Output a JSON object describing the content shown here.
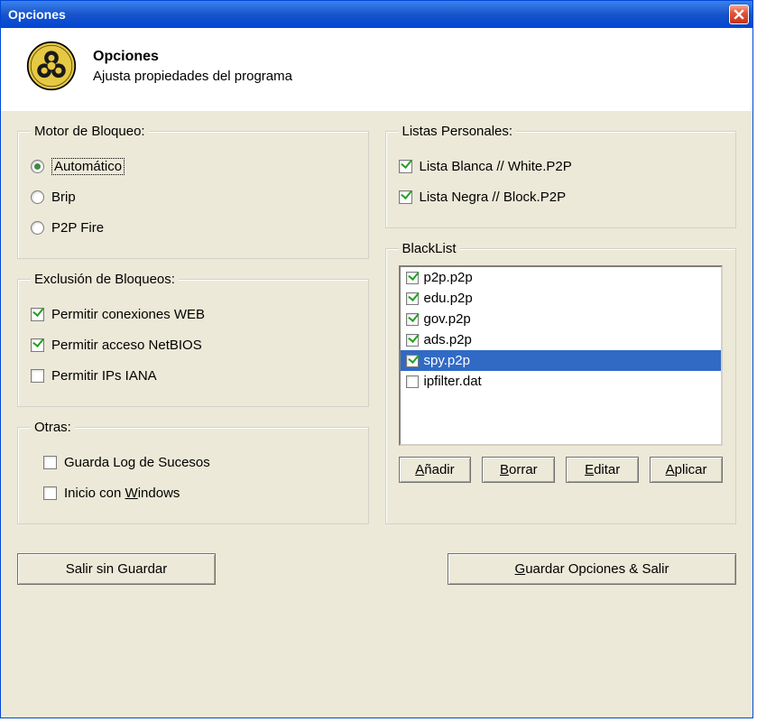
{
  "window": {
    "title": "Opciones"
  },
  "header": {
    "heading": "Opciones",
    "subtitle": "Ajusta propiedades  del programa"
  },
  "groups": {
    "engine": {
      "legend": "Motor de Bloqueo:",
      "options": [
        {
          "label": "Automático",
          "selected": true,
          "focused": true
        },
        {
          "label": "Brip",
          "selected": false,
          "focused": false
        },
        {
          "label": "P2P Fire",
          "selected": false,
          "focused": false
        }
      ]
    },
    "exclusion": {
      "legend": "Exclusión de Bloqueos:",
      "items": [
        {
          "label": "Permitir conexiones WEB",
          "checked": true
        },
        {
          "label": "Permitir acceso NetBIOS",
          "checked": true
        },
        {
          "label": "Permitir  IPs IANA",
          "checked": false
        }
      ]
    },
    "other": {
      "legend": "Otras:",
      "items": [
        {
          "label": "Guarda Log de Sucesos",
          "checked": false
        },
        {
          "label": "Inicio con ",
          "label_u": "W",
          "label_rest": "indows",
          "checked": false
        }
      ]
    },
    "personal": {
      "legend": "Listas Personales:",
      "items": [
        {
          "label": "Lista Blanca // White.P2P",
          "checked": true
        },
        {
          "label": "Lista Negra // Block.P2P",
          "checked": true
        }
      ]
    },
    "blacklist": {
      "legend": "BlackList",
      "items": [
        {
          "label": "p2p.p2p",
          "checked": true,
          "selected": false
        },
        {
          "label": "edu.p2p",
          "checked": true,
          "selected": false
        },
        {
          "label": "gov.p2p",
          "checked": true,
          "selected": false
        },
        {
          "label": "ads.p2p",
          "checked": true,
          "selected": false
        },
        {
          "label": "spy.p2p",
          "checked": true,
          "selected": true
        },
        {
          "label": "ipfilter.dat",
          "checked": false,
          "selected": false
        }
      ],
      "buttons": {
        "add": {
          "u": "A",
          "rest": "ñadir"
        },
        "del": {
          "u": "B",
          "rest": "orrar"
        },
        "edit": {
          "u": "E",
          "rest": "ditar"
        },
        "apply": {
          "u": "A",
          "rest": "plicar"
        }
      }
    }
  },
  "bottom": {
    "exit": "Salir sin Guardar",
    "save": {
      "u": "G",
      "rest": "uardar Opciones & Salir"
    }
  }
}
